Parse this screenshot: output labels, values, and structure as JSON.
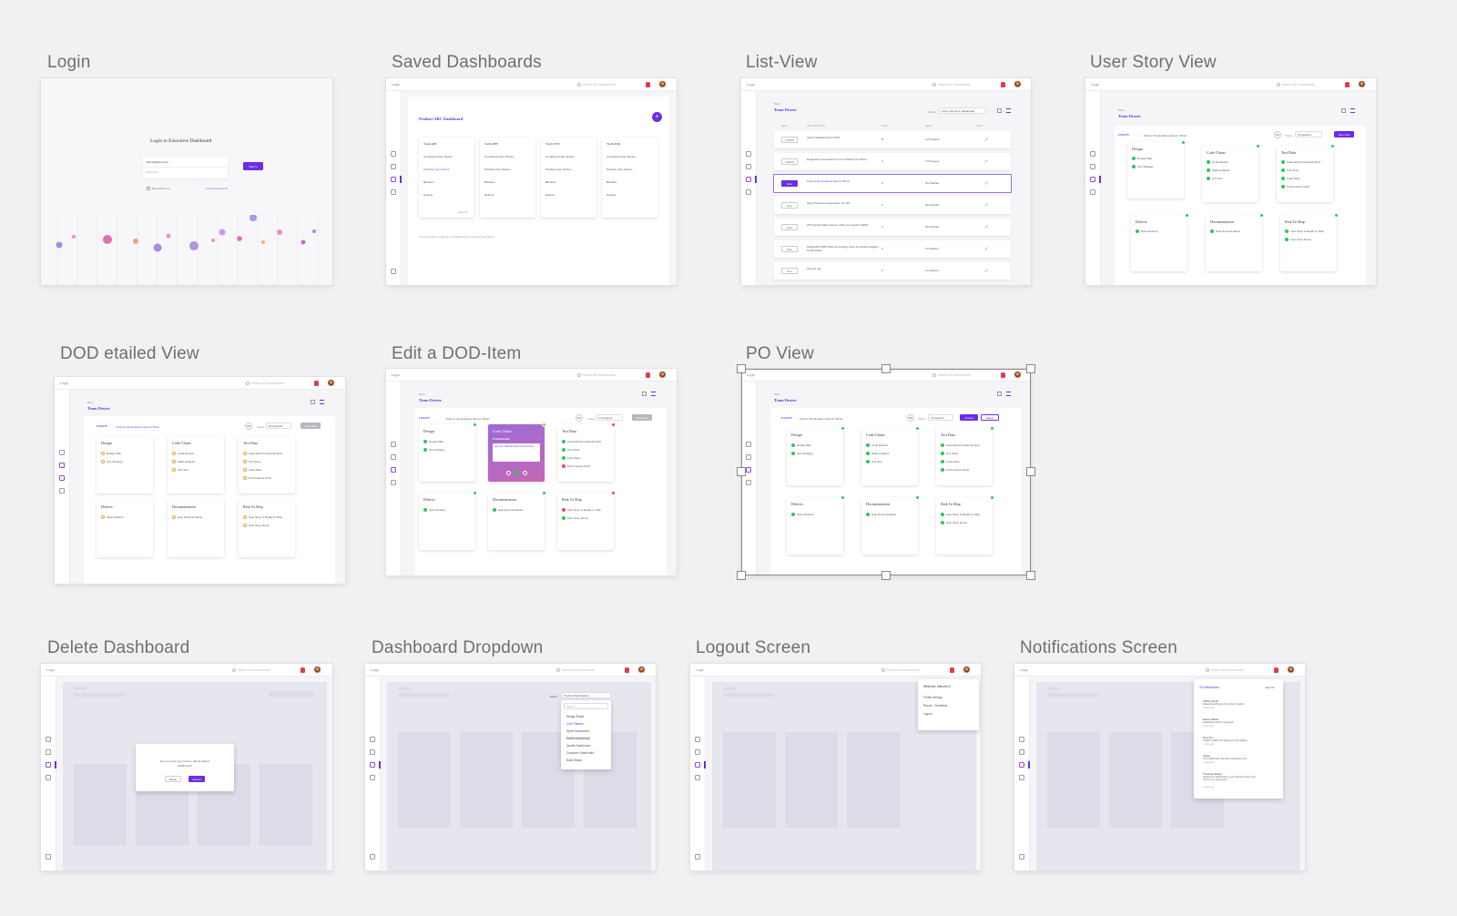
{
  "screens": {
    "login": {
      "label": "Login",
      "title": "Login to Executive Dashboard",
      "username": "marcelo@test.com",
      "password": "Password",
      "sign_in": "Sign In",
      "remember": "Remember me",
      "forgot": "Forgot Password?"
    },
    "saved": {
      "label": "Saved Dashboards",
      "logo": "Logo",
      "search": "Search All Dashboards",
      "heading": "Product ABC Dashboard",
      "teams": [
        {
          "name": "Team ABC",
          "s1": "Completed User Stories",
          "s2": "Pending User Stories",
          "s3": "Blockers",
          "s4": "Defects",
          "link": "View All"
        },
        {
          "name": "Team DEF",
          "s1": "Completed User Stories",
          "s2": "Pending User Stories",
          "s3": "Blockers",
          "s4": "Defects"
        },
        {
          "name": "Team XYZ",
          "s1": "Completed User Stories",
          "s2": "Pending User Stories",
          "s3": "Blockers",
          "s4": "Defects"
        },
        {
          "name": "Team PQR",
          "s1": "Completed User Stories",
          "s2": "Pending User Stories",
          "s3": "Blockers",
          "s4": "Defects"
        }
      ],
      "footer": "You can create a maximum of dashboards by using the  icon above"
    },
    "list": {
      "label": "List-View",
      "back": "Back",
      "team": "Team Dexter",
      "status_label": "Status",
      "status_value": "Users Stories in dashboard",
      "headers": [
        "Story",
        "User Story Name",
        "Points",
        "Status",
        "Action"
      ],
      "rows": [
        {
          "id": "US4270",
          "title": "Query Statistics from CICD",
          "pts": "8",
          "status": "In Progress"
        },
        {
          "id": "US4279",
          "title": "Regression test defects of CI in defects for Fibres",
          "pts": "3",
          "status": "In Progress"
        },
        {
          "id": "New",
          "title": "Failover OI automation fixes for Fibres",
          "pts": "3",
          "status": "Not Started"
        },
        {
          "id": "New",
          "title": "New Preference automation for CIS",
          "pts": "3",
          "status": "Not Started"
        },
        {
          "id": "New",
          "title": "API Support Mail Listener using my requires (SDK)",
          "pts": "3",
          "status": "Not Started"
        },
        {
          "id": "New",
          "title": "Fallout/Kill CDR Preserve existing order and defect flagged by DM fields",
          "pts": "3",
          "status": "Completed"
        },
        {
          "id": "New",
          "title": "User for Jig",
          "pts": "3",
          "status": "Completed"
        }
      ]
    },
    "userstory": {
      "label": "User Story View",
      "story_id": "US4279",
      "story_title": "Failover OI automation fixes for Fibres",
      "status_label": "Status",
      "status_value": "Completed",
      "btn": "Send Jira",
      "cards": [
        {
          "title": "Design",
          "items": [
            "Design Wiki",
            "Test Strategy"
          ]
        },
        {
          "title": "Code Charts",
          "items": [
            "Code Review",
            "Static Analysis",
            "Unit Test"
          ]
        },
        {
          "title": "Test Data",
          "items": [
            "Automated Functional Tests",
            "Unit Tests",
            "Load Tests",
            "Performance Tests"
          ]
        },
        {
          "title": "Defects",
          "items": [
            "Open Defects"
          ]
        },
        {
          "title": "Documentation",
          "items": [
            "Help Documentation"
          ]
        },
        {
          "title": "Risk To Ship",
          "items": [
            "User Story is Ready to Ship",
            "User Story Demo"
          ]
        }
      ]
    },
    "dod": {
      "label": "DOD etailed View",
      "status_value": "Not Started",
      "btn": "Send Jira",
      "circle": "0%"
    },
    "edit": {
      "label": "Edit a DOD-Item",
      "status_value": "In Progress",
      "circle": "0%",
      "purple_title": "Code Charts",
      "purple_sub": "Code Review",
      "purple_input": "Add your Code Review comments here"
    },
    "po": {
      "label": "PO View",
      "accept": "Accept",
      "reject": "Reject",
      "circle": "0%"
    },
    "delete": {
      "label": "Delete Dashboard",
      "question": "Are you sure you want to delete Defect dashboard?",
      "delete": "Delete",
      "cancel": "Cancel"
    },
    "dropdown": {
      "label": "Dashboard Dropdown",
      "select_label": "Select",
      "select_value": "Product Dashboards",
      "search": "Search",
      "items": [
        "Design Board",
        "Core Planner",
        "Sprint Dashboard",
        "Defect Dashboard",
        "Quality Dashboard",
        "Customer Dashboard",
        "Build Status"
      ]
    },
    "logout": {
      "label": "Logout Screen",
      "welcome": "Welcome, Marcelo N",
      "items": [
        "Profile settings",
        "Report - Feedback",
        "Logout"
      ]
    },
    "notif": {
      "label": "Notifications Screen",
      "head": "32 Notifications",
      "clear": "Clear All",
      "items": [
        {
          "who": "T.Brent Smith",
          "msg": "Deleted dashboard & functions created",
          "time": "2 hours ago"
        },
        {
          "who": "Danny Robert",
          "msg": "Dashboard share is great job",
          "time": "2 days ago"
        },
        {
          "who": "Jimy Son",
          "msg": "Jimjeft modified the design for the widgets",
          "time": "1 week ago"
        },
        {
          "who": "Jimlee",
          "msg": "Your dashboard has been refreshed of de...",
          "time": "1 week ago"
        },
        {
          "who": "T.Herman Brown",
          "msg": "Deleted the dashboard, go we deleted simply, and review is to and people",
          "time": "1 week ago"
        }
      ]
    }
  },
  "colors": {
    "accent": "#6a2ee0",
    "success": "#2fc65a",
    "danger": "#e94b4b",
    "warning": "#e8a23a",
    "bell": "#e23a4f"
  }
}
